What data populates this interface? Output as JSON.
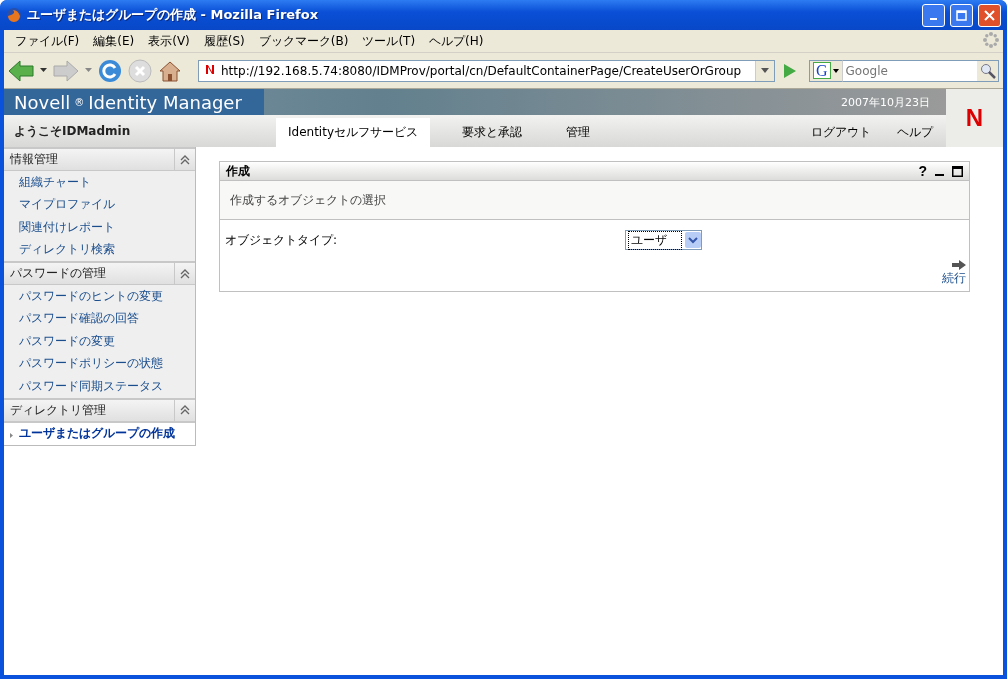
{
  "window": {
    "title": "ユーザまたはグループの作成 - Mozilla Firefox"
  },
  "menu": [
    "ファイル(F)",
    "編集(E)",
    "表示(V)",
    "履歴(S)",
    "ブックマーク(B)",
    "ツール(T)",
    "ヘルプ(H)"
  ],
  "toolbar": {
    "url": "http://192.168.5.74:8080/IDMProv/portal/cn/DefaultContainerPage/CreateUserOrGroup",
    "search_placeholder": "Google",
    "search_engine": "G"
  },
  "banner": {
    "brand": "Novell",
    "mark": "®",
    "product": "Identity Manager",
    "date": "2007年10月23日",
    "welcome": "ようこそIDMadmin",
    "logo": "N"
  },
  "tabs": [
    {
      "label": "Identityセルフサービス",
      "selected": true
    },
    {
      "label": "要求と承認",
      "selected": false
    },
    {
      "label": "管理",
      "selected": false
    }
  ],
  "header_links": [
    "ログアウト",
    "ヘルプ"
  ],
  "sidebar": [
    {
      "title": "情報管理",
      "items": [
        {
          "label": "組織チャート",
          "selected": false
        },
        {
          "label": "マイプロファイル",
          "selected": false
        },
        {
          "label": "関連付けレポート",
          "selected": false
        },
        {
          "label": "ディレクトリ検索",
          "selected": false
        }
      ]
    },
    {
      "title": "パスワードの管理",
      "items": [
        {
          "label": "パスワードのヒントの変更",
          "selected": false
        },
        {
          "label": "パスワード確認の回答",
          "selected": false
        },
        {
          "label": "パスワードの変更",
          "selected": false
        },
        {
          "label": "パスワードポリシーの状態",
          "selected": false
        },
        {
          "label": "パスワード同期ステータス",
          "selected": false
        }
      ]
    },
    {
      "title": "ディレクトリ管理",
      "items": [
        {
          "label": "ユーザまたはグループの作成",
          "selected": true
        }
      ]
    }
  ],
  "panel": {
    "title": "作成",
    "help": "?",
    "subtitle": "作成するオブジェクトの選択",
    "field_label": "オブジェクトタイプ:",
    "field_value": "ユーザ",
    "continue": "続行"
  }
}
